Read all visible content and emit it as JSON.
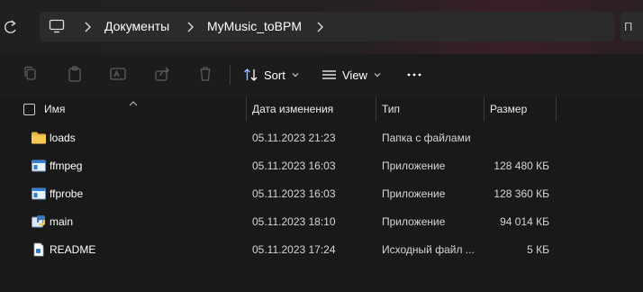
{
  "breadcrumb": {
    "items": [
      "Документы",
      "MyMusic_toBPM"
    ]
  },
  "search": {
    "placeholder": "П"
  },
  "toolbar": {
    "sort_label": "Sort",
    "view_label": "View",
    "icons": [
      "copy-icon",
      "paste-icon",
      "rename-icon",
      "share-icon",
      "delete-icon",
      "sort-icon",
      "view-icon",
      "more-icon"
    ]
  },
  "columns": {
    "name": "Имя",
    "date": "Дата изменения",
    "type": "Тип",
    "size": "Размер"
  },
  "files": [
    {
      "name": "loads",
      "date": "05.11.2023 21:23",
      "type": "Папка с файлами",
      "size": "",
      "icon": "folder-icon"
    },
    {
      "name": "ffmpeg",
      "date": "05.11.2023 16:03",
      "type": "Приложение",
      "size": "128 480 КБ",
      "icon": "application-icon"
    },
    {
      "name": "ffprobe",
      "date": "05.11.2023 16:03",
      "type": "Приложение",
      "size": "128 360 КБ",
      "icon": "application-icon"
    },
    {
      "name": "main",
      "date": "05.11.2023 18:10",
      "type": "Приложение",
      "size": "94 014 КБ",
      "icon": "python-app-icon"
    },
    {
      "name": "README",
      "date": "05.11.2023 17:24",
      "type": "Исходный файл ...",
      "size": "5 КБ",
      "icon": "document-icon"
    }
  ],
  "colors": {
    "background": "#191919",
    "folder": "#f3c14b",
    "app_blue": "#4aa3ff"
  }
}
